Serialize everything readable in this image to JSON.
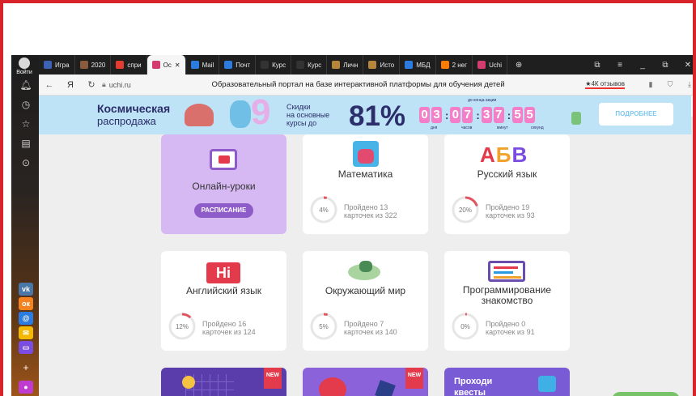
{
  "browser": {
    "login_label": "Войти",
    "tabs": [
      {
        "label": "Игра",
        "color": "#3e62b3"
      },
      {
        "label": "2020",
        "color": "#8a5c3c"
      },
      {
        "label": "спри",
        "color": "#e33b2f"
      },
      {
        "label": "Ос",
        "color": "#d23c6e",
        "active": true
      },
      {
        "label": "Mail",
        "color": "#2b7be0"
      },
      {
        "label": "Почт",
        "color": "#2b7be0"
      },
      {
        "label": "Курс",
        "color": "#333"
      },
      {
        "label": "Курс",
        "color": "#333"
      },
      {
        "label": "Личн",
        "color": "#b8863b"
      },
      {
        "label": "Исто",
        "color": "#b8863b"
      },
      {
        "label": "МБД",
        "color": "#2b7be0"
      },
      {
        "label": "2 нег",
        "color": "#ff7a00"
      },
      {
        "label": "Uchi",
        "color": "#d23c6e"
      }
    ],
    "url": "uchi.ru",
    "page_title": "Образовательный портал на базе интерактивной платформы для обучения детей",
    "reviews": "★4К отзывов"
  },
  "banner": {
    "title_line1": "Космическая",
    "title_line2": "распродажа",
    "discount_text": [
      "Скидки",
      "на основные",
      "курсы до"
    ],
    "percent": "81%",
    "until_end": "до конца акции",
    "digits": [
      "0",
      "3",
      "0",
      "7",
      "3",
      "7",
      "5",
      "5"
    ],
    "units": [
      "дня",
      "часов",
      "минут",
      "секунд"
    ],
    "more_button": "ПОДРОБНЕЕ"
  },
  "cards": [
    {
      "name": "Онлайн-уроки",
      "button": "РАСПИСАНИЕ"
    },
    {
      "name": "Математика",
      "progress_percent": 4,
      "progress_label": "4%",
      "line1": "Пройдено 13",
      "line2": "карточек из 322"
    },
    {
      "name": "Русский язык",
      "progress_percent": 20,
      "progress_label": "20%",
      "line1": "Пройдено 19",
      "line2": "карточек из 93"
    },
    {
      "name": "Английский язык",
      "progress_percent": 12,
      "progress_label": "12%",
      "line1": "Пройдено 16",
      "line2": "карточек из 124"
    },
    {
      "name": "Окружающий мир",
      "progress_percent": 5,
      "progress_label": "5%",
      "line1": "Пройдено 7",
      "line2": "карточек из 140"
    },
    {
      "name": "Программирование",
      "name2": "знакомство",
      "progress_percent": 0,
      "progress_label": "0%",
      "line1": "Пройдено 0",
      "line2": "карточек из 91"
    }
  ],
  "bottom_cards": [
    {
      "badge": "NEW"
    },
    {
      "badge": "NEW"
    },
    {
      "quest_line1": "Проходи",
      "quest_line2": "квесты"
    }
  ],
  "icons": {
    "abv": "АБВ",
    "hi": "Hi"
  }
}
